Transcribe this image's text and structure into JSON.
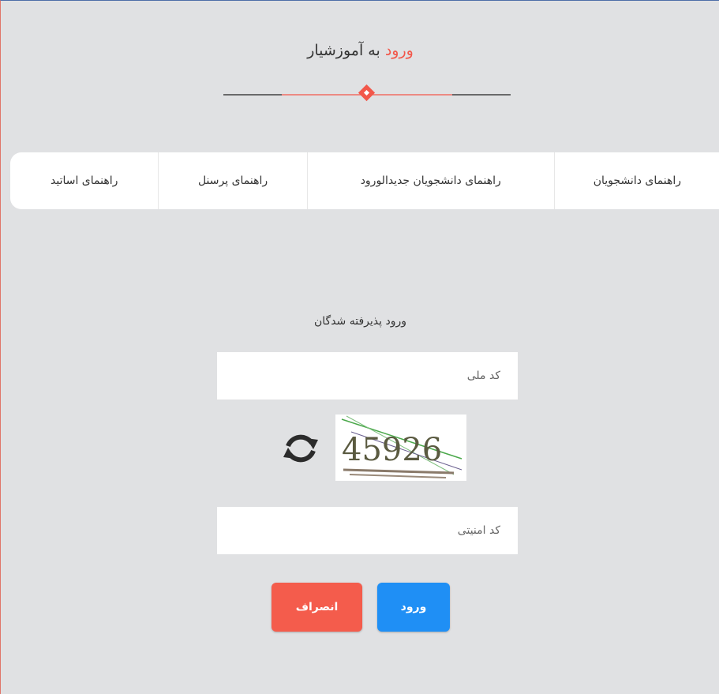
{
  "header": {
    "title_accent": "ورود",
    "title_rest": " به آموزشیار"
  },
  "colors": {
    "accent": "#f2574a",
    "primary": "#1f8ff5",
    "background": "#e0e1e3"
  },
  "tabs": [
    {
      "label": "راهنمای دانشجویان"
    },
    {
      "label": "راهنمای دانشجویان جدیدالورود"
    },
    {
      "label": "راهنمای پرسنل"
    },
    {
      "label": "راهنمای اساتید"
    }
  ],
  "form": {
    "heading": "ورود پذیرفته شدگان",
    "national_code_placeholder": "کد ملی",
    "security_code_placeholder": "کد امنیتی",
    "refresh_icon": "refresh-icon",
    "captcha_text": "45926",
    "login_label": "ورود",
    "cancel_label": "انصراف"
  }
}
